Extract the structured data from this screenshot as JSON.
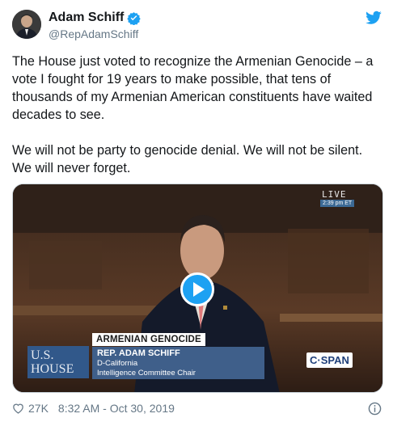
{
  "author": {
    "name": "Adam Schiff",
    "handle": "@RepAdamSchiff",
    "verified": true
  },
  "tweet": {
    "text": "The House just voted to recognize the Armenian Genocide – a vote I fought for 19 years to make possible, that tens of thousands of my Armenian American constituents have waited decades to see.\n\nWe will not be party to genocide denial. We will not be silent. We will never forget."
  },
  "video": {
    "live_label": "LIVE",
    "live_time": "2:39 pm ET",
    "chyron_title": "ARMENIAN GENOCIDE",
    "chyron_name": "REP. ADAM SCHIFF",
    "chyron_line1": "D-California",
    "chyron_line2": "Intelligence Committee Chair",
    "house_logo_line1": "U.S.",
    "house_logo_line2": "HOUSE",
    "network": "C·SPAN",
    "play_icon": "play-icon"
  },
  "footer": {
    "likes": "27K",
    "timestamp": "8:32 AM - Oct 30, 2019"
  },
  "colors": {
    "twitter_blue": "#1da1f2",
    "text": "#14171a",
    "muted": "#657786",
    "chyron_blue": "#3f5f8a"
  }
}
